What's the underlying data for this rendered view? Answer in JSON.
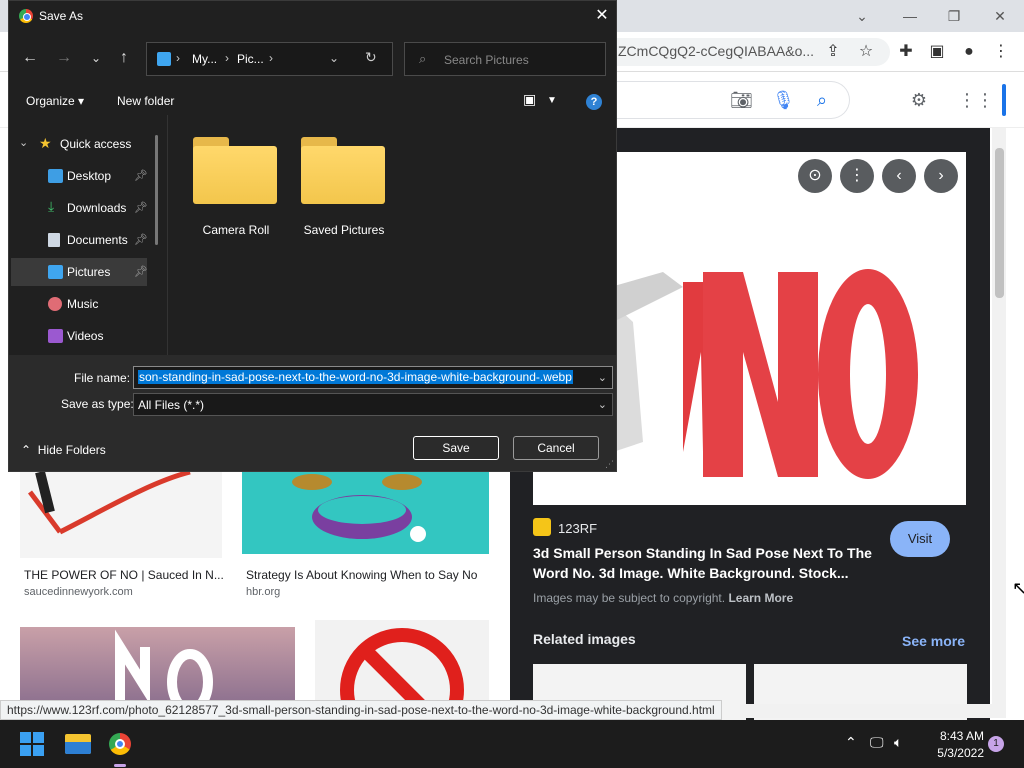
{
  "browser": {
    "url_fragment": "ZCmCQgQ2-cCegQIABAA&o...",
    "status_url": "https://www.123rf.com/photo_62128577_3d-small-person-standing-in-sad-pose-next-to-the-word-no-3d-image-white-background.html"
  },
  "results": [
    {
      "title": "THE POWER OF NO | Sauced In N...",
      "site": "saucedinnewyork.com"
    },
    {
      "title": "Strategy Is About Knowing When to Say No",
      "site": "hbr.org"
    }
  ],
  "preview": {
    "source": "123RF",
    "title": "3d Small Person Standing In Sad Pose Next To The Word No. 3d Image. White Background. Stock...",
    "visit": "Visit",
    "copyright": "Images may be subject to copyright.",
    "learn_more": "Learn More",
    "related": "Related images",
    "see_more": "See more",
    "image_word": "NO"
  },
  "dialog": {
    "title": "Save As",
    "address_parts": [
      "My...",
      "Pic..."
    ],
    "search_placeholder": "Search Pictures",
    "organize": "Organize",
    "new_folder": "New folder",
    "nav": {
      "quick_access": "Quick access",
      "items": [
        {
          "label": "Desktop",
          "pinned": true
        },
        {
          "label": "Downloads",
          "pinned": true
        },
        {
          "label": "Documents",
          "pinned": true
        },
        {
          "label": "Pictures",
          "pinned": true
        },
        {
          "label": "Music",
          "pinned": false
        },
        {
          "label": "Videos",
          "pinned": false
        }
      ]
    },
    "folders": [
      "Camera Roll",
      "Saved Pictures"
    ],
    "file_name_label": "File name:",
    "file_name_value": "son-standing-in-sad-pose-next-to-the-word-no-3d-image-white-background-.webp",
    "save_type_label": "Save as type:",
    "save_type_value": "All Files (*.*)",
    "hide_folders": "Hide Folders",
    "save": "Save",
    "cancel": "Cancel"
  },
  "taskbar": {
    "time": "8:43 AM",
    "date": "5/3/2022",
    "notifications": "1"
  },
  "colors": {
    "dialog_bg": "#202020",
    "selection": "#0078d7",
    "accent": "#8ab4f8"
  }
}
